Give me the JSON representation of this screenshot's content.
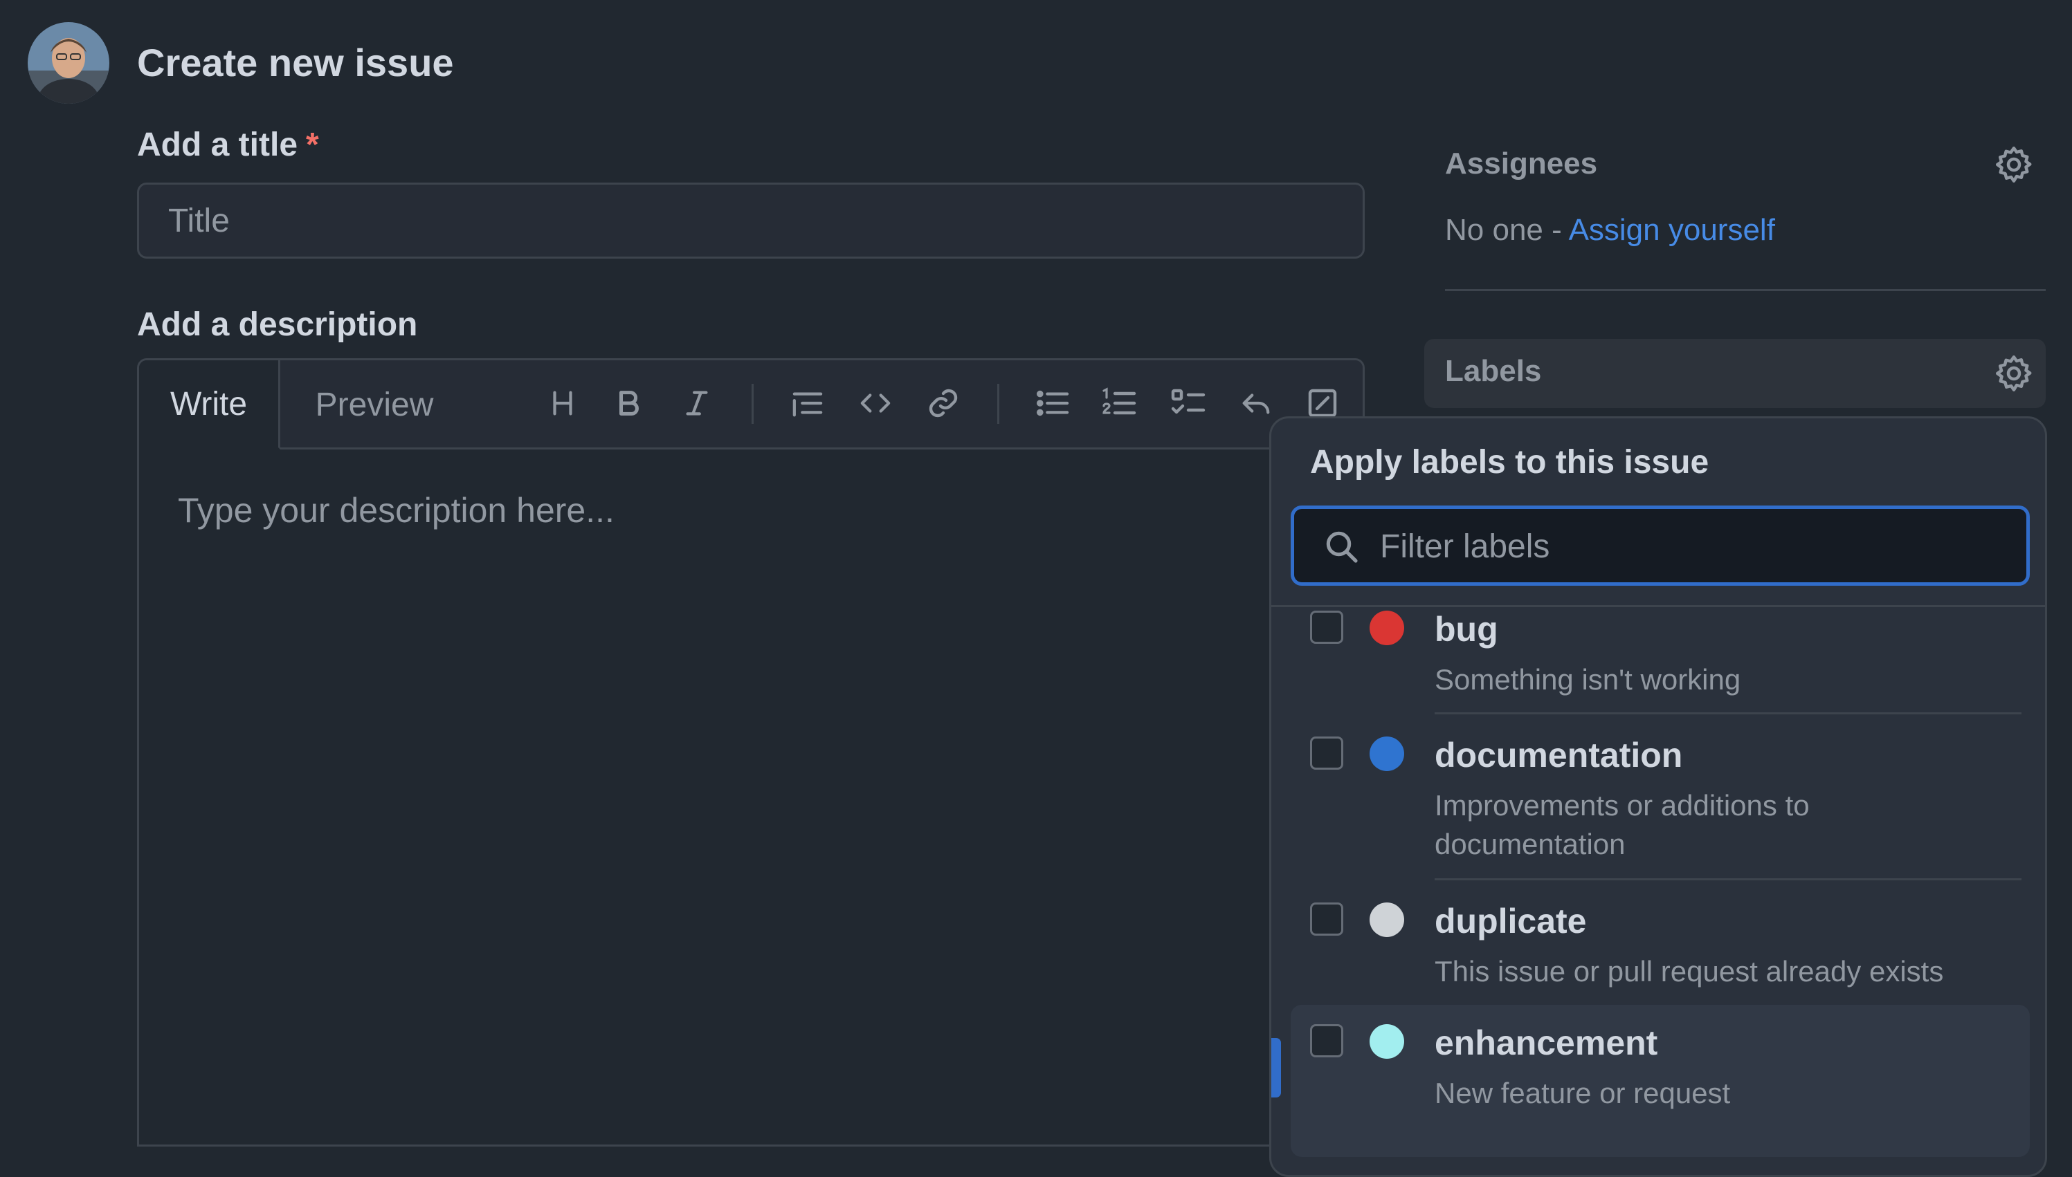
{
  "header": {
    "title": "Create new issue"
  },
  "title_field": {
    "label": "Add a title",
    "required_mark": "*",
    "placeholder": "Title",
    "value": ""
  },
  "description": {
    "label": "Add a description",
    "tabs": [
      "Write",
      "Preview"
    ],
    "active_tab": "Write",
    "placeholder": "Type your description here...",
    "toolbar_icons": [
      "heading-icon",
      "bold-icon",
      "italic-icon",
      "quote-icon",
      "code-icon",
      "link-icon",
      "unordered-list-icon",
      "ordered-list-icon",
      "task-list-icon",
      "reply-icon",
      "fullscreen-icon"
    ]
  },
  "sidebar": {
    "assignees": {
      "heading": "Assignees",
      "none_text": "No one - ",
      "assign_link": "Assign yourself"
    },
    "labels": {
      "heading": "Labels"
    }
  },
  "labels_popover": {
    "title": "Apply labels to this issue",
    "filter_placeholder": "Filter labels",
    "items": [
      {
        "name": "bug",
        "description": "Something isn't working",
        "color": "#da3633",
        "checked": false
      },
      {
        "name": "documentation",
        "description": "Improvements or additions to documentation",
        "color": "#2f74d0",
        "checked": false
      },
      {
        "name": "duplicate",
        "description": "This issue or pull request already exists",
        "color": "#cfd3d7",
        "checked": false
      },
      {
        "name": "enhancement",
        "description": "New feature or request",
        "color": "#a2eeef",
        "checked": false
      }
    ]
  },
  "colors": {
    "background": "#212830",
    "accent": "#316dca",
    "link": "#478be6",
    "required": "#f47067"
  }
}
